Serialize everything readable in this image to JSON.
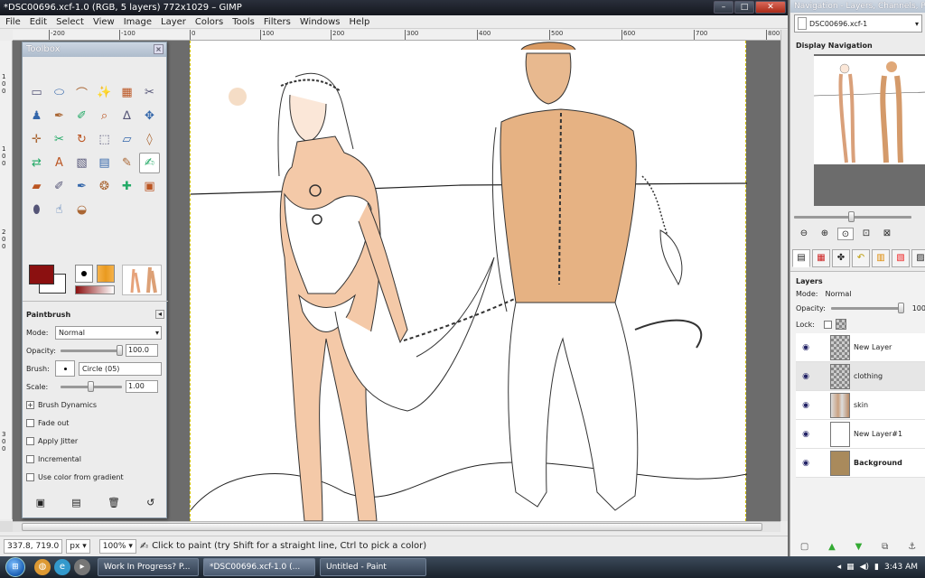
{
  "window": {
    "title": "*DSC00696.xcf-1.0 (RGB, 5 layers) 772x1029 – GIMP",
    "controls": [
      "–",
      "□",
      "✕"
    ]
  },
  "menu": [
    "File",
    "Edit",
    "Select",
    "View",
    "Image",
    "Layer",
    "Colors",
    "Tools",
    "Filters",
    "Windows",
    "Help"
  ],
  "ruler": {
    "top": [
      "-200",
      "-100",
      "0",
      "100",
      "200",
      "300",
      "400",
      "500",
      "600",
      "700",
      "800"
    ],
    "left": [
      "1",
      "0",
      "0",
      "1",
      "0",
      "0",
      "2",
      "0",
      "0",
      "3"
    ]
  },
  "toolbox": {
    "title": "Toolbox",
    "close": "×",
    "tools": [
      {
        "name": "rect-select",
        "glyph": "▭"
      },
      {
        "name": "ellipse-select",
        "glyph": "⬭"
      },
      {
        "name": "free-select",
        "glyph": "⌒"
      },
      {
        "name": "fuzzy-select",
        "glyph": "✨"
      },
      {
        "name": "color-select",
        "glyph": "▦"
      },
      {
        "name": "scissors",
        "glyph": "✂"
      },
      {
        "name": "foreground-select",
        "glyph": "♟"
      },
      {
        "name": "paths",
        "glyph": "✒"
      },
      {
        "name": "color-picker",
        "glyph": "✐"
      },
      {
        "name": "zoom",
        "glyph": "⌕"
      },
      {
        "name": "measure",
        "glyph": "∆"
      },
      {
        "name": "move",
        "glyph": "✥"
      },
      {
        "name": "align",
        "glyph": "✛"
      },
      {
        "name": "crop",
        "glyph": "✂"
      },
      {
        "name": "rotate",
        "glyph": "↻"
      },
      {
        "name": "scale",
        "glyph": "⬚"
      },
      {
        "name": "shear",
        "glyph": "▱"
      },
      {
        "name": "perspective",
        "glyph": "◊"
      },
      {
        "name": "flip",
        "glyph": "⇄"
      },
      {
        "name": "text",
        "glyph": "A"
      },
      {
        "name": "bucket-fill",
        "glyph": "▧"
      },
      {
        "name": "blend",
        "glyph": "▤"
      },
      {
        "name": "pencil",
        "glyph": "✎"
      },
      {
        "name": "paintbrush",
        "glyph": "✍"
      },
      {
        "name": "eraser",
        "glyph": "▰"
      },
      {
        "name": "airbrush",
        "glyph": "✐"
      },
      {
        "name": "ink",
        "glyph": "✒"
      },
      {
        "name": "clone",
        "glyph": "❂"
      },
      {
        "name": "heal",
        "glyph": "✚"
      },
      {
        "name": "perspective-clone",
        "glyph": "▣"
      },
      {
        "name": "blur",
        "glyph": "⬮"
      },
      {
        "name": "smudge",
        "glyph": "☝"
      },
      {
        "name": "dodge-burn",
        "glyph": "◒"
      }
    ],
    "colors": {
      "fg": "#8b1010",
      "bg": "#ffffff",
      "gradient_from": "#8b1010",
      "gradient_to": "#ffffff"
    }
  },
  "tool_options": {
    "title": "Paintbrush",
    "mode_label": "Mode:",
    "mode_value": "Normal",
    "opacity_label": "Opacity:",
    "opacity_value": "100.0",
    "brush_label": "Brush:",
    "brush_value": "Circle (05)",
    "scale_label": "Scale:",
    "scale_value": "1.00",
    "dynamics_label": "Brush Dynamics",
    "checkboxes": [
      "Fade out",
      "Apply Jitter",
      "Incremental",
      "Use color from gradient"
    ]
  },
  "status": {
    "coords": "337.8, 719.0",
    "unit": "px",
    "zoom": "100%",
    "message": "Click to paint (try Shift for a straight line, Ctrl to pick a color)"
  },
  "dock": {
    "title": "Navigation - Layers, Channels, Pat",
    "image_select": "DSC00696.xcf-1",
    "nav_label": "Display Navigation",
    "layers_label": "Layers",
    "mode_label": "Mode:",
    "mode_value": "Normal",
    "opacity_label": "Opacity:",
    "opacity_value": "100",
    "lock_label": "Lock:",
    "layers": [
      {
        "name": "New Layer",
        "thumb": "checker",
        "bold": false,
        "active": false
      },
      {
        "name": "clothing",
        "thumb": "checker",
        "bold": false,
        "active": true
      },
      {
        "name": "skin",
        "thumb": "skin",
        "bold": false,
        "active": false
      },
      {
        "name": "New Layer#1",
        "thumb": "white",
        "bold": false,
        "active": false
      },
      {
        "name": "Background",
        "thumb": "paper",
        "bold": true,
        "active": false
      }
    ]
  },
  "taskbar": {
    "start": "⊞",
    "tasks": [
      "Work In Progress? P...",
      "*DSC00696.xcf-1.0 (...",
      "Untitled - Paint"
    ],
    "time": "3:43 AM"
  },
  "colors": {
    "skin": "#e6b283",
    "skin_light": "#f7d6bf",
    "line": "#222222"
  }
}
